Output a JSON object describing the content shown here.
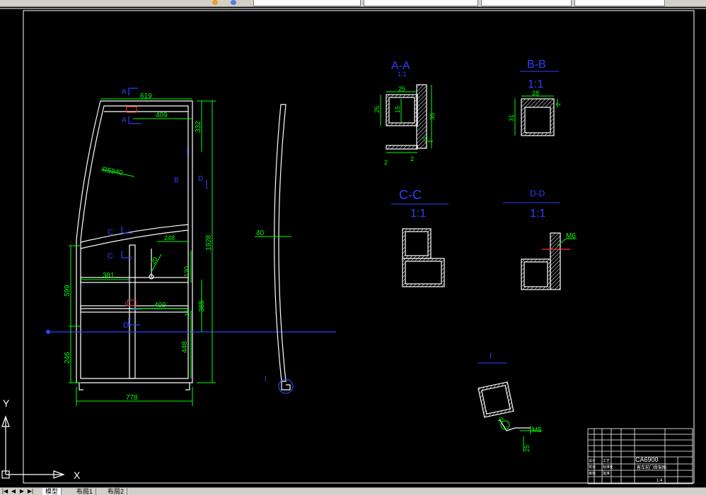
{
  "colors": {
    "background": "#000000",
    "outline": "#ffffff",
    "dimension": "#00ff00",
    "section": "#3040ff",
    "hatch": "#ffffff",
    "cut": "#ff3030"
  },
  "toolbar": {
    "icons": [
      "toolbar-icon-a",
      "toolbar-icon-b"
    ]
  },
  "tabs": {
    "model": "模型",
    "layout1": "布局1",
    "layout2": "布局2"
  },
  "ucs": {
    "x": "X",
    "y": "Y"
  },
  "main_view": {
    "label_a_top": "A",
    "label_a_bottom": "A",
    "label_b": "B",
    "label_d_right": "D",
    "label_c_top": "C",
    "label_c_bottom": "C",
    "label_d_lower": "D",
    "label_i": "I",
    "radius": "R5940",
    "dim_619": "619",
    "dim_409_top": "409",
    "dim_332": "332",
    "dim_1928": "1928",
    "dim_248": "248",
    "dim_381": "381",
    "dim_130": "130",
    "dim_599": "599",
    "dim_409_mid": "409",
    "dim_385": "385",
    "dim_246": "246",
    "dim_448": "448",
    "dim_778": "778",
    "dim_20": "20",
    "dim_16": "16"
  },
  "side_view": {
    "dim_40": "40",
    "label_i": "I"
  },
  "sections": {
    "aa": {
      "title": "A-A",
      "scale": "1:1",
      "d25_top": "25",
      "d25_left": "25",
      "d15": "15",
      "d36": "36",
      "d2_bottom": "2",
      "d2_left": "2",
      "d2_right": "2"
    },
    "bb": {
      "title": "B-B",
      "scale": "1:1",
      "d28": "28",
      "d31": "31",
      "d2": "2"
    },
    "cc": {
      "title": "C-C",
      "scale": "1:1"
    },
    "dd": {
      "title": "D-D",
      "scale": "1:1",
      "thread": "M6"
    },
    "detail_i": {
      "title": "I",
      "thread": "M5",
      "d25": "25",
      "d10": "10"
    }
  },
  "title_block": {
    "product": "CA6900",
    "sub": "客车前门骨架图",
    "scale": "1:4",
    "cells": [
      "设计",
      "校对",
      "审核",
      "工艺",
      "标准化",
      "批准"
    ]
  }
}
